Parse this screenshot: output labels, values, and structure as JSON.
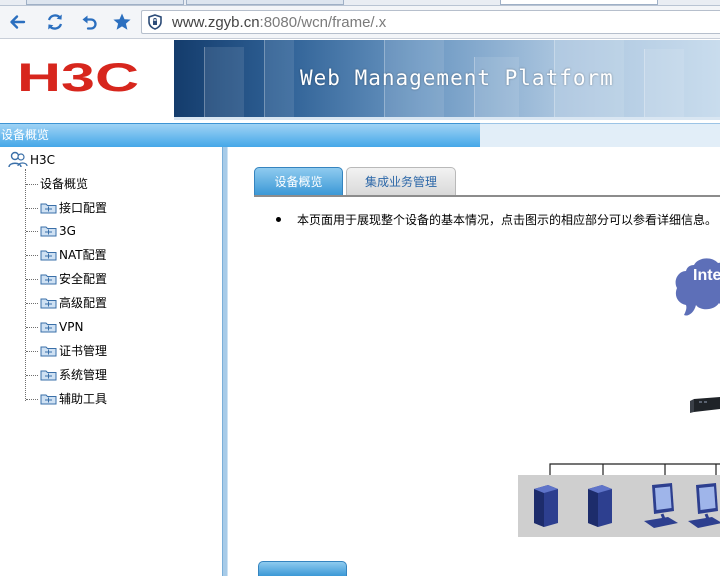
{
  "browser": {
    "url_host": "www.zgyb.cn",
    "url_path": ":8080/wcn/frame/.x"
  },
  "banner": {
    "logo_text": "H3C",
    "title": "Web Management Platform"
  },
  "section_title": "设备概览",
  "tree": {
    "root_label": "H3C",
    "items": [
      {
        "label": "设备概览",
        "folder": false
      },
      {
        "label": "接口配置",
        "folder": true
      },
      {
        "label": "3G",
        "folder": true
      },
      {
        "label": "NAT配置",
        "folder": true
      },
      {
        "label": "安全配置",
        "folder": true
      },
      {
        "label": "高级配置",
        "folder": true
      },
      {
        "label": "VPN",
        "folder": true
      },
      {
        "label": "证书管理",
        "folder": true
      },
      {
        "label": "系统管理",
        "folder": true
      },
      {
        "label": "辅助工具",
        "folder": true
      }
    ]
  },
  "main": {
    "tabs": [
      {
        "label": "设备概览",
        "active": true
      },
      {
        "label": "集成业务管理",
        "active": false
      }
    ],
    "info_text": "本页面用于展现整个设备的基本情况，点击图示的相应部分可以参看详细信息。",
    "diagram": {
      "cloud_label": "Inte"
    }
  },
  "colors": {
    "logo_red": "#d7261d",
    "accent_blue": "#3b98d6",
    "tab_inactive_text": "#2c67a8"
  }
}
